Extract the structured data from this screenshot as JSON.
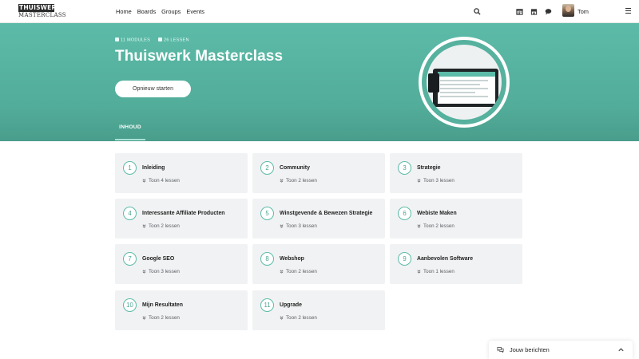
{
  "colors": {
    "accent": "#5cbba8",
    "hero_bg": "#52ad9a",
    "card_bg": "#f1f2f3"
  },
  "logo": {
    "line1": "THUISWERK",
    "line2": "MASTERCLASS"
  },
  "nav": {
    "items": [
      "Home",
      "Boards",
      "Groups",
      "Events"
    ]
  },
  "header_icons": [
    "search-icon",
    "calendar-icon",
    "store-icon",
    "chat-icon"
  ],
  "user": {
    "name": "Tom"
  },
  "hero": {
    "modules": "11 MODULES",
    "lessons": "26 LESSEN",
    "title": "Thuiswerk Masterclass",
    "button": "Opnieuw starten",
    "tab": "INHOUD"
  },
  "modules": [
    {
      "num": "1",
      "title": "Inleiding",
      "lessons": "Toon 4 lessen"
    },
    {
      "num": "2",
      "title": "Community",
      "lessons": "Toon 2 lessen"
    },
    {
      "num": "3",
      "title": "Strategie",
      "lessons": "Toon 3 lessen"
    },
    {
      "num": "4",
      "title": "Interessante Affiliate Producten",
      "lessons": "Toon 2 lessen"
    },
    {
      "num": "5",
      "title": "Winstgevende & Bewezen Strategie",
      "lessons": "Toon 3 lessen"
    },
    {
      "num": "6",
      "title": "Webiste Maken",
      "lessons": "Toon 2 lessen"
    },
    {
      "num": "7",
      "title": "Google SEO",
      "lessons": "Toon 3 lessen"
    },
    {
      "num": "8",
      "title": "Webshop",
      "lessons": "Toon 2 lessen"
    },
    {
      "num": "9",
      "title": "Aanbevolen Software",
      "lessons": "Toon 1 lessen"
    },
    {
      "num": "10",
      "title": "Mijn Resultaten",
      "lessons": "Toon 2 lessen"
    },
    {
      "num": "11",
      "title": "Upgrade",
      "lessons": "Toon 2 lessen"
    }
  ],
  "messages": {
    "label": "Jouw berichten"
  }
}
